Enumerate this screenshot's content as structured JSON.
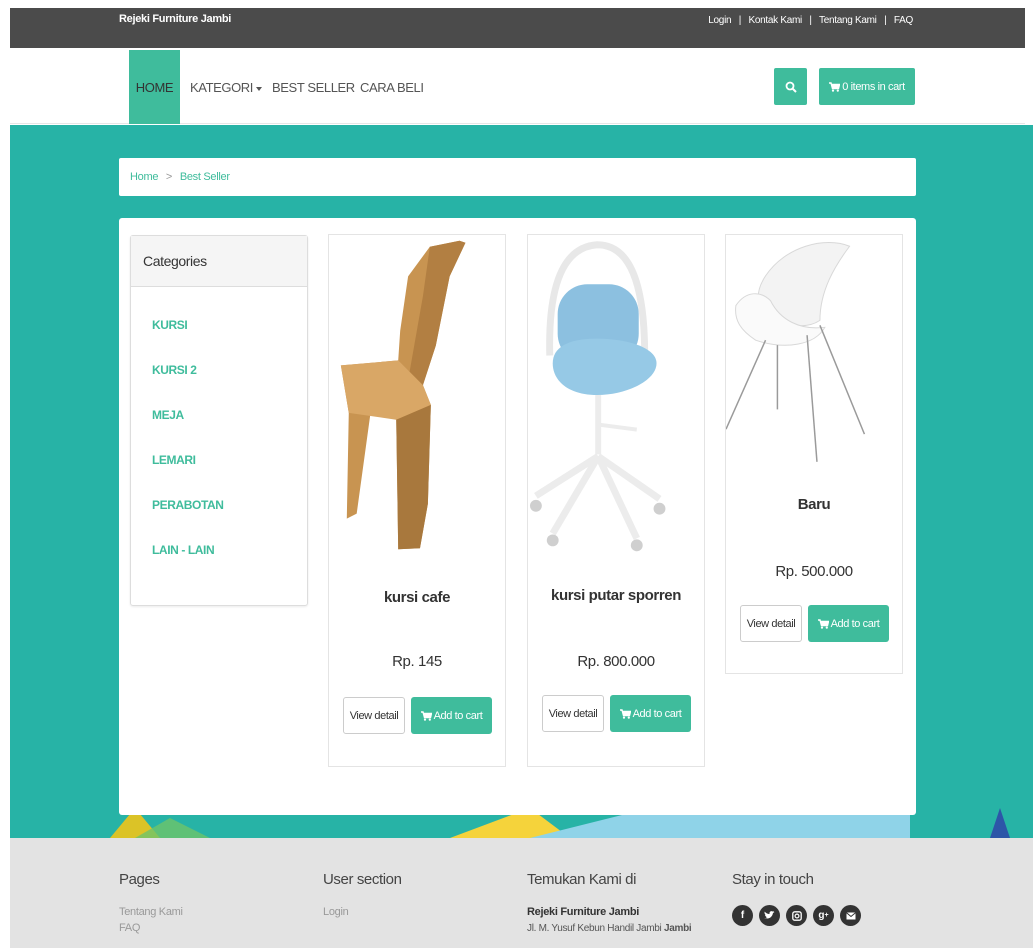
{
  "header": {
    "brand": "Rejeki Furniture Jambi",
    "links": [
      "Login",
      "Kontak Kami",
      "Tentang Kami",
      "FAQ"
    ],
    "separator": "|"
  },
  "nav": {
    "home": "HOME",
    "kategori": "KATEGORI",
    "best_seller": "BEST SELLER",
    "cara_beli": "CARA BELI",
    "cart_label": "0 items in cart"
  },
  "breadcrumb": {
    "home": "Home",
    "separator": ">",
    "current": "Best Seller"
  },
  "sidebar": {
    "title": "Categories",
    "items": [
      "KURSI",
      "KURSI 2",
      "MEJA",
      "LEMARI",
      "PERABOTAN",
      "LAIN - LAIN"
    ]
  },
  "products": [
    {
      "name": "kursi cafe",
      "price": "Rp. 145",
      "view_label": "View detail",
      "add_label": "Add to cart"
    },
    {
      "name": "kursi putar sporren",
      "price": "Rp. 800.000",
      "view_label": "View detail",
      "add_label": "Add to cart"
    },
    {
      "name": "Baru",
      "price": "Rp. 500.000",
      "view_label": "View detail",
      "add_label": "Add to cart"
    }
  ],
  "footer": {
    "pages_title": "Pages",
    "pages_links": [
      "Tentang Kami",
      "FAQ"
    ],
    "user_title": "User section",
    "user_links": [
      "Login"
    ],
    "find_title": "Temukan Kami di",
    "store_name": "Rejeki Furniture Jambi",
    "address_prefix": "Jl. M. Yusuf Kebun Handil Jambi",
    "address_city": "Jambi",
    "stay_title": "Stay in touch",
    "social_icons": [
      "facebook-icon",
      "twitter-icon",
      "instagram-icon",
      "google-plus-icon",
      "email-icon"
    ]
  },
  "colors": {
    "accent": "#3fbc9c",
    "teal_bg": "#27b3a6",
    "topbar": "#4b4b4b",
    "footer_bg": "#e3e3e3"
  }
}
